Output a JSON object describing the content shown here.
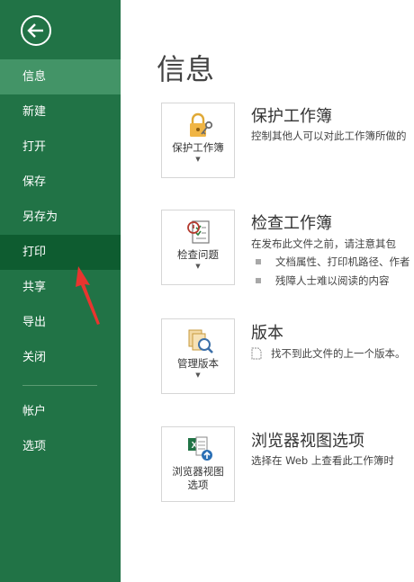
{
  "sidebar": {
    "back_icon": "back-arrow-icon",
    "items": [
      {
        "label": "信息",
        "state": "selected"
      },
      {
        "label": "新建",
        "state": "normal"
      },
      {
        "label": "打开",
        "state": "normal"
      },
      {
        "label": "保存",
        "state": "normal"
      },
      {
        "label": "另存为",
        "state": "normal"
      },
      {
        "label": "打印",
        "state": "highlighted"
      },
      {
        "label": "共享",
        "state": "normal"
      },
      {
        "label": "导出",
        "state": "normal"
      },
      {
        "label": "关闭",
        "state": "normal"
      }
    ],
    "bottom_items": [
      {
        "label": "帐户"
      },
      {
        "label": "选项"
      }
    ],
    "colors": {
      "background": "#217346",
      "selected": "#439467",
      "highlight": "#0e5c30",
      "annotation_arrow": "#e8352f"
    }
  },
  "main": {
    "title": "信息",
    "sections": [
      {
        "tile_label": "保护工作簿",
        "tile_icon": "lock-key-icon",
        "heading": "保护工作簿",
        "description": "控制其他人可以对此工作簿所做的"
      },
      {
        "tile_label": "检查问题",
        "tile_icon": "inspect-checklist-icon",
        "heading": "检查工作簿",
        "description": "在发布此文件之前，请注意其包",
        "bullets": [
          "文档属性、打印机路径、作者",
          "残障人士难以阅读的内容"
        ]
      },
      {
        "tile_label": "管理版本",
        "tile_icon": "manage-versions-icon",
        "heading": "版本",
        "description": "找不到此文件的上一个版本。",
        "description_icon": "document-icon"
      },
      {
        "tile_label_line1": "浏览器视图",
        "tile_label_line2": "选项",
        "tile_icon": "excel-browser-icon",
        "heading": "浏览器视图选项",
        "description": "选择在 Web 上查看此工作簿时"
      }
    ]
  }
}
